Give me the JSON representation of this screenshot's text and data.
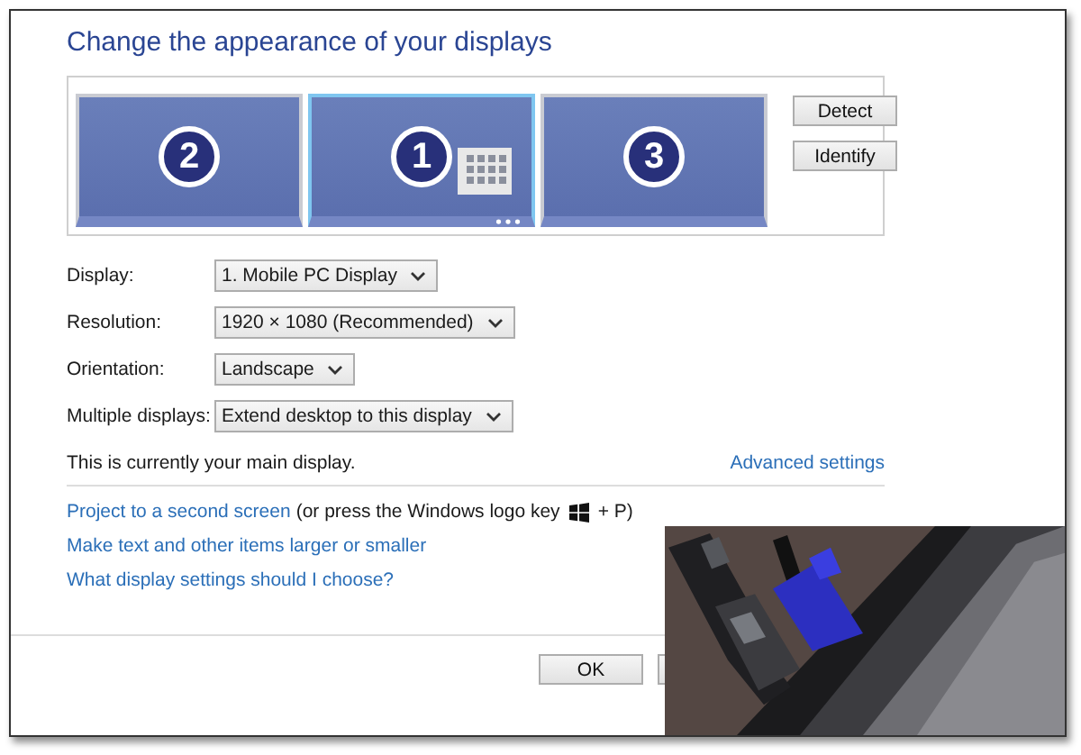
{
  "title": "Change the appearance of your displays",
  "displays": [
    {
      "number": "2",
      "selected": false,
      "main": false
    },
    {
      "number": "1",
      "selected": true,
      "main": true
    },
    {
      "number": "3",
      "selected": false,
      "main": false
    }
  ],
  "side_buttons": [
    "Detect",
    "Identify"
  ],
  "settings": [
    {
      "label": "Display:",
      "value": "1. Mobile PC Display"
    },
    {
      "label": "Resolution:",
      "value": "1920 × 1080 (Recommended)"
    },
    {
      "label": "Orientation:",
      "value": "Landscape"
    },
    {
      "label": "Multiple displays:",
      "value": "Extend desktop to this display"
    }
  ],
  "main_display_note": "This is currently your main display.",
  "advanced_link": "Advanced settings",
  "project_link": "Project to a second screen",
  "project_hint_before": "(or press the Windows logo key",
  "project_hint_after": "+ P)",
  "links": [
    "Make text and other items larger or smaller",
    "What display settings should I choose?"
  ],
  "buttons": [
    "OK"
  ],
  "photo": {
    "kind": "picture"
  }
}
